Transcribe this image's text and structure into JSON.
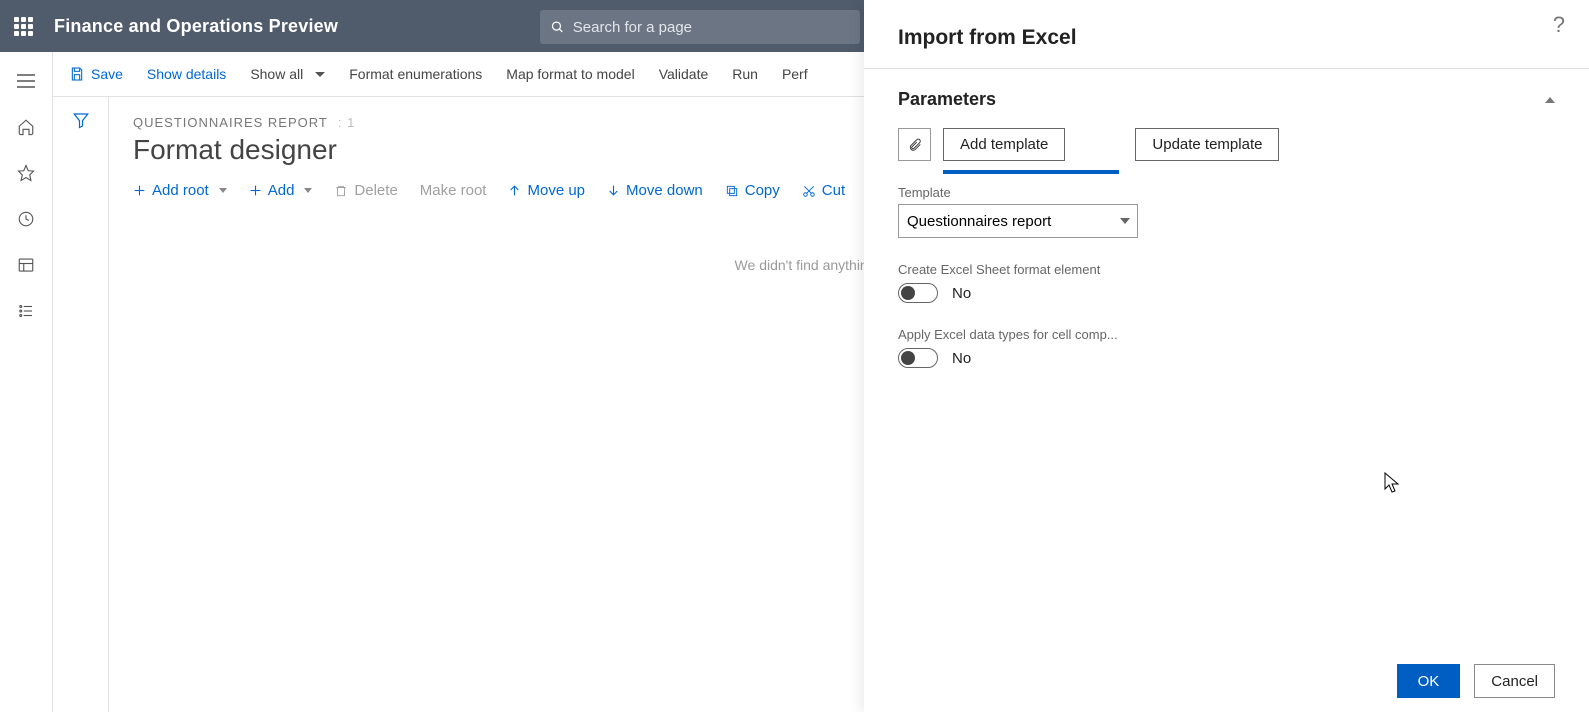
{
  "header": {
    "app_title": "Finance and Operations Preview",
    "search_placeholder": "Search for a page"
  },
  "action_bar": {
    "save": "Save",
    "show_details": "Show details",
    "show_all": "Show all",
    "format_enum": "Format enumerations",
    "map_format": "Map format to model",
    "validate": "Validate",
    "run": "Run",
    "perf": "Perf"
  },
  "workspace": {
    "breadcrumb_title": "QUESTIONNAIRES REPORT",
    "breadcrumb_index": ": 1",
    "page_title": "Format designer",
    "toolbar": {
      "add_root": "Add root",
      "add": "Add",
      "delete": "Delete",
      "make_root": "Make root",
      "move_up": "Move up",
      "move_down": "Move down",
      "copy": "Copy",
      "cut": "Cut"
    },
    "empty_msg": "We didn't find anything to show here."
  },
  "panel": {
    "title": "Import from Excel",
    "section": "Parameters",
    "add_template": "Add template",
    "update_template": "Update template",
    "template_field_label": "Template",
    "template_value": "Questionnaires report",
    "create_sheet_label": "Create Excel Sheet format element",
    "create_sheet_value": "No",
    "apply_types_label": "Apply Excel data types for cell comp...",
    "apply_types_value": "No",
    "ok": "OK",
    "cancel": "Cancel"
  }
}
